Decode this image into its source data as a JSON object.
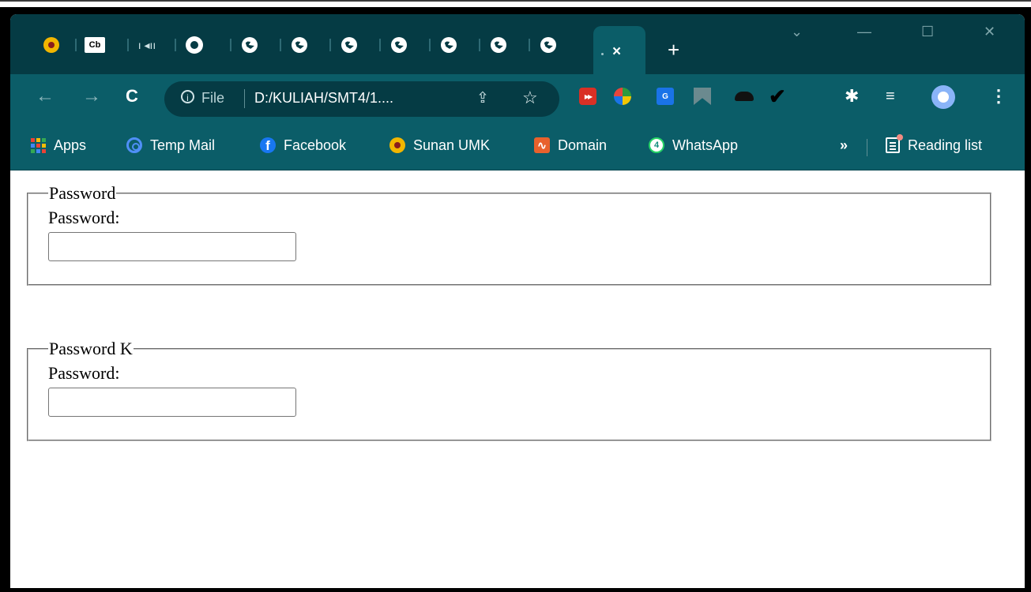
{
  "browser": {
    "tabs": [
      {
        "icon": "sunan-umk-icon"
      },
      {
        "icon": "cb-icon",
        "text": "Cb"
      },
      {
        "icon": "audio-playing-icon"
      },
      {
        "icon": "github-icon"
      },
      {
        "icon": "globe-icon"
      },
      {
        "icon": "globe-icon"
      },
      {
        "icon": "globe-icon"
      },
      {
        "icon": "globe-icon"
      },
      {
        "icon": "globe-icon"
      },
      {
        "icon": "globe-icon"
      },
      {
        "icon": "globe-icon"
      }
    ],
    "active_tab_close": "×",
    "new_tab": "+",
    "window_controls": {
      "dropdown": "⌄",
      "minimize": "—",
      "maximize": "☐",
      "close": "✕"
    },
    "toolbar": {
      "back": "←",
      "forward": "→",
      "reload": "C",
      "info": "i",
      "scheme_chip": "File",
      "url": "D:/KULIAH/SMT4/1....",
      "share": "⇪",
      "star": "☆"
    },
    "extensions": [
      "video-speed-icon",
      "idm-icon",
      "google-translate-icon",
      "bookmark-tag-icon",
      "spy-hat-icon",
      "checkmark-icon",
      "puzzle-icon",
      "media-queue-icon",
      "profile-avatar-icon"
    ],
    "bookmarks": [
      {
        "icon": "apps-grid-icon",
        "label": "Apps"
      },
      {
        "icon": "temp-mail-icon",
        "label": "Temp Mail"
      },
      {
        "icon": "facebook-icon",
        "label": "Facebook"
      },
      {
        "icon": "sunan-umk-icon",
        "label": "Sunan UMK"
      },
      {
        "icon": "domain-icon",
        "label": "Domain"
      },
      {
        "icon": "whatsapp-icon",
        "label": "WhatsApp"
      }
    ],
    "bookmarks_more": "»",
    "reading_list": "Reading list",
    "colors": {
      "tabstrip": "#053b44",
      "toolbar": "#0b5d68"
    }
  },
  "page": {
    "fieldsets": [
      {
        "legend": "Password",
        "label": "Password:",
        "value": ""
      },
      {
        "legend": "Password K",
        "label": "Password:",
        "value": ""
      }
    ]
  }
}
